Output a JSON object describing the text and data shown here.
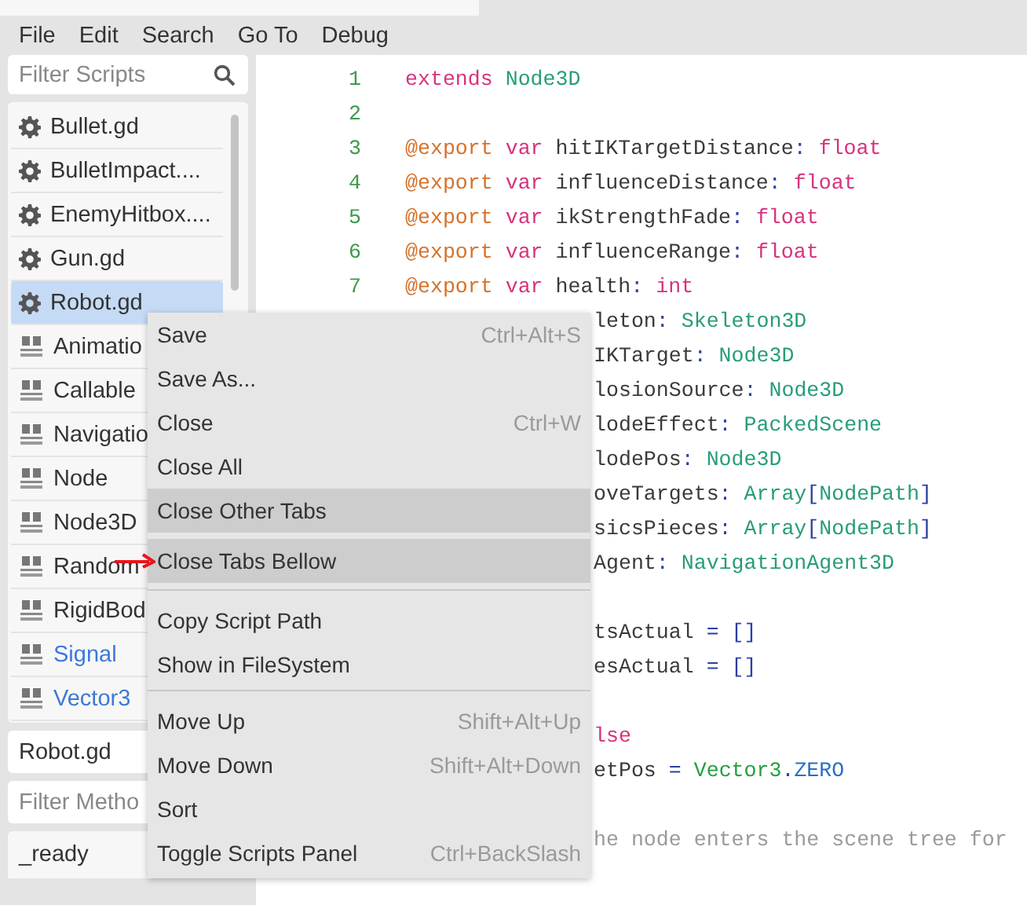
{
  "menubar": [
    "File",
    "Edit",
    "Search",
    "Go To",
    "Debug"
  ],
  "script_filter": {
    "placeholder": "Filter Scripts"
  },
  "scripts": [
    {
      "kind": "script",
      "label": "Bullet.gd",
      "selected": false,
      "color": "#333333"
    },
    {
      "kind": "script",
      "label": "BulletImpact....",
      "selected": false,
      "color": "#333333"
    },
    {
      "kind": "script",
      "label": "EnemyHitbox....",
      "selected": false,
      "color": "#333333"
    },
    {
      "kind": "script",
      "label": "Gun.gd",
      "selected": false,
      "color": "#333333"
    },
    {
      "kind": "script",
      "label": "Robot.gd",
      "selected": true,
      "color": "#333333"
    },
    {
      "kind": "doc",
      "label": "Animatio",
      "selected": false,
      "color": "#333333"
    },
    {
      "kind": "doc",
      "label": "Callable",
      "selected": false,
      "color": "#333333"
    },
    {
      "kind": "doc",
      "label": "Navigatio",
      "selected": false,
      "color": "#333333"
    },
    {
      "kind": "doc",
      "label": "Node",
      "selected": false,
      "color": "#333333"
    },
    {
      "kind": "doc",
      "label": "Node3D",
      "selected": false,
      "color": "#333333"
    },
    {
      "kind": "doc",
      "label": "Random",
      "selected": false,
      "color": "#333333"
    },
    {
      "kind": "doc",
      "label": "RigidBod",
      "selected": false,
      "color": "#333333"
    },
    {
      "kind": "doc",
      "label": "Signal",
      "selected": false,
      "color": "#3d78d8"
    },
    {
      "kind": "doc",
      "label": "Vector3",
      "selected": false,
      "color": "#3d78d8"
    }
  ],
  "current_script": "Robot.gd",
  "method_filter": {
    "placeholder": "Filter Metho"
  },
  "methods": [
    "_ready"
  ],
  "code_lines": [
    {
      "clipped": false,
      "number": "1",
      "tokens": [
        {
          "kind": "kw",
          "text": "extends"
        },
        {
          "kind": "type",
          "text": " Node3D"
        }
      ]
    },
    {
      "clipped": false,
      "number": "2"
    },
    {
      "clipped": false,
      "number": "3",
      "tokens": [
        {
          "kind": "annot",
          "text": "@export"
        },
        {
          "kind": "kw",
          "text": " var"
        },
        {
          "kind": "id",
          "text": " hitIKTargetDistance"
        },
        {
          "kind": "punct",
          "text": ":"
        },
        {
          "kind": "kw",
          "text": " float"
        }
      ]
    },
    {
      "clipped": false,
      "number": "4",
      "tokens": [
        {
          "kind": "annot",
          "text": "@export"
        },
        {
          "kind": "kw",
          "text": " var"
        },
        {
          "kind": "id",
          "text": " influenceDistance"
        },
        {
          "kind": "punct",
          "text": ":"
        },
        {
          "kind": "kw",
          "text": " float"
        }
      ]
    },
    {
      "clipped": false,
      "number": "5",
      "tokens": [
        {
          "kind": "annot",
          "text": "@export"
        },
        {
          "kind": "kw",
          "text": " var"
        },
        {
          "kind": "id",
          "text": " ikStrengthFade"
        },
        {
          "kind": "punct",
          "text": ":"
        },
        {
          "kind": "kw",
          "text": " float"
        }
      ]
    },
    {
      "clipped": false,
      "number": "6",
      "tokens": [
        {
          "kind": "annot",
          "text": "@export"
        },
        {
          "kind": "kw",
          "text": " var"
        },
        {
          "kind": "id",
          "text": " influenceRange"
        },
        {
          "kind": "punct",
          "text": ":"
        },
        {
          "kind": "kw",
          "text": " float"
        }
      ]
    },
    {
      "clipped": false,
      "number": "7",
      "tokens": [
        {
          "kind": "annot",
          "text": "@export"
        },
        {
          "kind": "kw",
          "text": " var"
        },
        {
          "kind": "id",
          "text": " health"
        },
        {
          "kind": "punct",
          "text": ":"
        },
        {
          "kind": "kw",
          "text": " int"
        }
      ]
    },
    {
      "clipped": true,
      "tokens": [
        {
          "kind": "id",
          "text": "leton"
        },
        {
          "kind": "punct",
          "text": ":"
        },
        {
          "kind": "type",
          "text": " Skeleton3D"
        }
      ]
    },
    {
      "clipped": true,
      "tokens": [
        {
          "kind": "id",
          "text": "IKTarget"
        },
        {
          "kind": "punct",
          "text": ":"
        },
        {
          "kind": "type",
          "text": " Node3D"
        }
      ]
    },
    {
      "clipped": true,
      "tokens": [
        {
          "kind": "id",
          "text": "losionSource"
        },
        {
          "kind": "punct",
          "text": ":"
        },
        {
          "kind": "type",
          "text": " Node3D"
        }
      ]
    },
    {
      "clipped": true,
      "tokens": [
        {
          "kind": "id",
          "text": "lodeEffect"
        },
        {
          "kind": "punct",
          "text": ":"
        },
        {
          "kind": "type",
          "text": " PackedScene"
        }
      ]
    },
    {
      "clipped": true,
      "tokens": [
        {
          "kind": "id",
          "text": "lodePos"
        },
        {
          "kind": "punct",
          "text": ":"
        },
        {
          "kind": "type",
          "text": " Node3D"
        }
      ]
    },
    {
      "clipped": true,
      "tokens": [
        {
          "kind": "id",
          "text": "oveTargets"
        },
        {
          "kind": "punct",
          "text": ":"
        },
        {
          "kind": "type",
          "text": " Array"
        },
        {
          "kind": "punct",
          "text": "["
        },
        {
          "kind": "type",
          "text": "NodePath"
        },
        {
          "kind": "punct",
          "text": "]"
        }
      ]
    },
    {
      "clipped": true,
      "tokens": [
        {
          "kind": "id",
          "text": "sicsPieces"
        },
        {
          "kind": "punct",
          "text": ":"
        },
        {
          "kind": "type",
          "text": " Array"
        },
        {
          "kind": "punct",
          "text": "["
        },
        {
          "kind": "type",
          "text": "NodePath"
        },
        {
          "kind": "punct",
          "text": "]"
        }
      ]
    },
    {
      "clipped": true,
      "tokens": [
        {
          "kind": "id",
          "text": "Agent"
        },
        {
          "kind": "punct",
          "text": ":"
        },
        {
          "kind": "type",
          "text": " NavigationAgent3D"
        }
      ]
    },
    {
      "clipped": true
    },
    {
      "clipped": true,
      "tokens": [
        {
          "kind": "id",
          "text": "tsActual"
        },
        {
          "kind": "punct",
          "text": " = []"
        }
      ]
    },
    {
      "clipped": true,
      "tokens": [
        {
          "kind": "id",
          "text": "esActual"
        },
        {
          "kind": "punct",
          "text": " = []"
        }
      ]
    },
    {
      "clipped": true
    },
    {
      "clipped": true,
      "tokens": [
        {
          "kind": "kw",
          "text": "lse"
        }
      ]
    },
    {
      "clipped": true,
      "tokens": [
        {
          "kind": "id",
          "text": "etPos"
        },
        {
          "kind": "punct",
          "text": " ="
        },
        {
          "kind": "builtin",
          "text": " Vector3"
        },
        {
          "kind": "punct",
          "text": "."
        },
        {
          "kind": "const",
          "text": "ZERO"
        }
      ]
    },
    {
      "clipped": true
    },
    {
      "clipped": true,
      "tokens": [
        {
          "kind": "comment",
          "text": "he node enters the scene tree for"
        }
      ]
    }
  ],
  "context_menu": [
    {
      "kind": "item",
      "label": "Save",
      "shortcut": "Ctrl+Alt+S",
      "highlighted": false
    },
    {
      "kind": "item",
      "label": "Save As...",
      "highlighted": false
    },
    {
      "kind": "item",
      "label": "Close",
      "shortcut": "Ctrl+W",
      "highlighted": false
    },
    {
      "kind": "item",
      "label": "Close All",
      "highlighted": false
    },
    {
      "kind": "item",
      "label": "Close Other Tabs",
      "highlighted": true
    },
    {
      "kind": "item",
      "label": "Close Tabs Bellow",
      "highlighted": true
    },
    {
      "kind": "separator"
    },
    {
      "kind": "item",
      "label": "Copy Script Path",
      "highlighted": false
    },
    {
      "kind": "item",
      "label": "Show in FileSystem",
      "highlighted": false
    },
    {
      "kind": "separator"
    },
    {
      "kind": "item",
      "label": "Move Up",
      "shortcut": "Shift+Alt+Up",
      "highlighted": false
    },
    {
      "kind": "item",
      "label": "Move Down",
      "shortcut": "Shift+Alt+Down",
      "highlighted": false
    },
    {
      "kind": "item",
      "label": "Sort",
      "highlighted": false
    },
    {
      "kind": "item",
      "label": "Toggle Scripts Panel",
      "shortcut": "Ctrl+BackSlash",
      "highlighted": false
    }
  ]
}
